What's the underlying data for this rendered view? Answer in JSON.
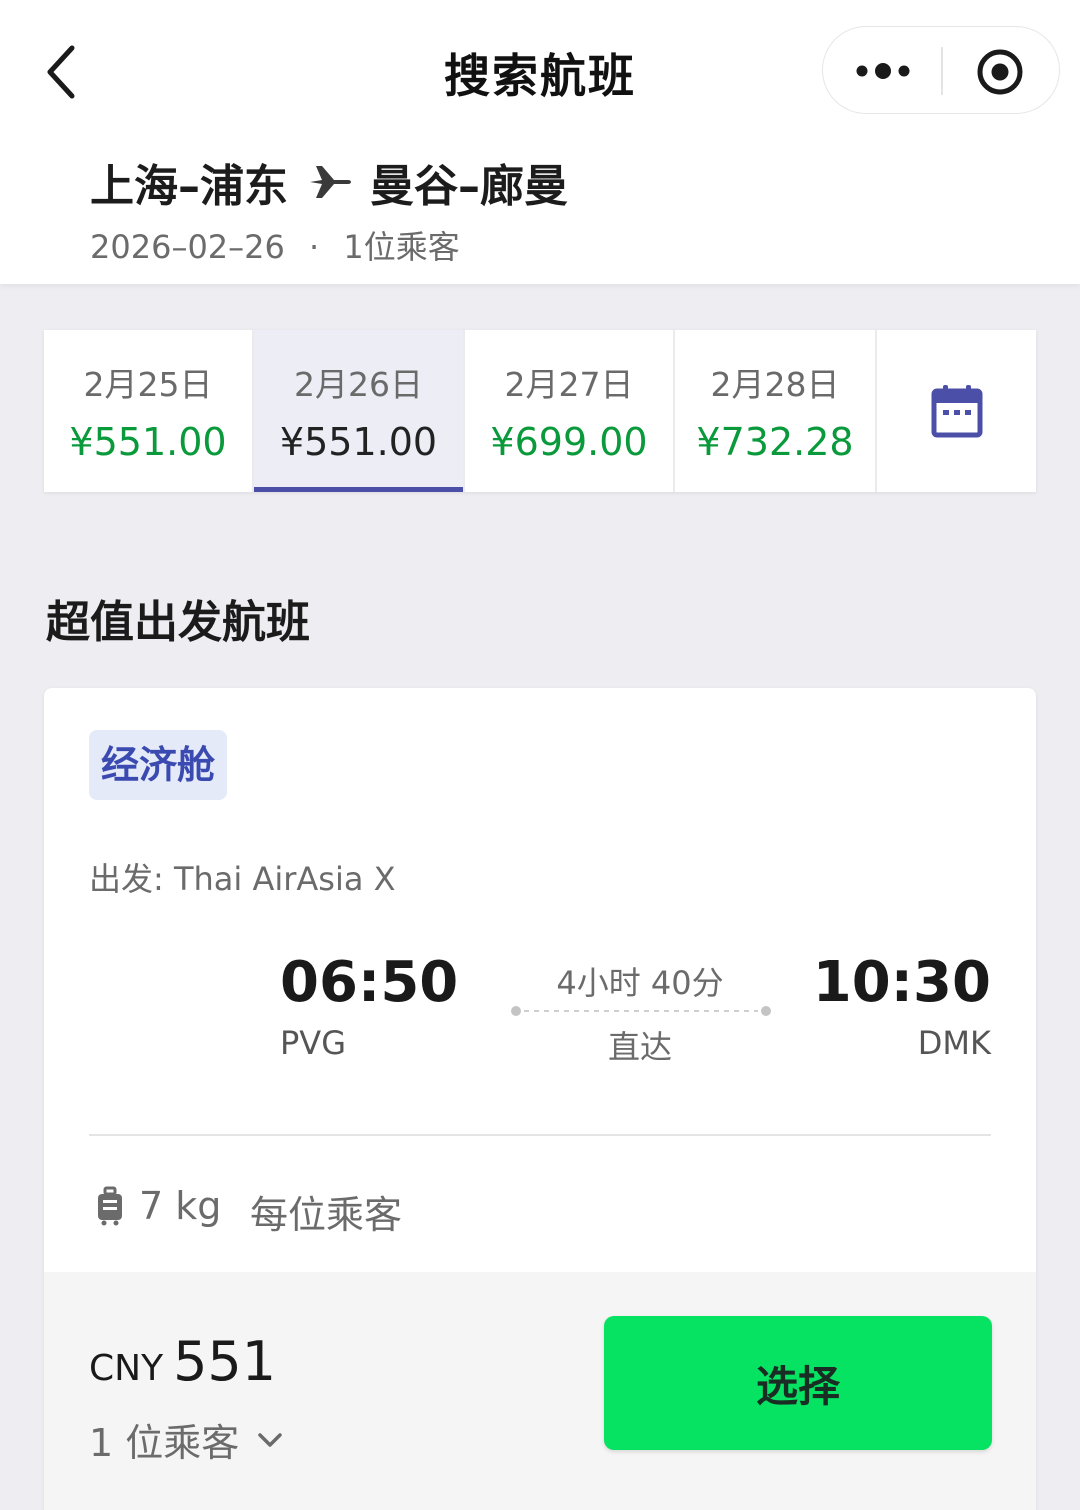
{
  "header": {
    "title": "搜索航班",
    "route_from": "上海–浦东",
    "route_to": "曼谷–廊曼",
    "date": "2026–02–26",
    "separator": "·",
    "passengers": "1位乘客"
  },
  "dates": [
    {
      "date": "2月25日",
      "price": "¥551.00",
      "selected": false
    },
    {
      "date": "2月26日",
      "price": "¥551.00",
      "selected": true
    },
    {
      "date": "2月27日",
      "price": "¥699.00",
      "selected": false
    },
    {
      "date": "2月28日",
      "price": "¥732.28",
      "selected": false
    }
  ],
  "section_title": "超值出发航班",
  "flight": {
    "cabin": "经济舱",
    "airline": "出发: Thai AirAsia X",
    "departure_time": "06:50",
    "departure_code": "PVG",
    "arrival_time": "10:30",
    "arrival_code": "DMK",
    "duration": "4小时 40分",
    "stops": "直达",
    "baggage_weight": "7 kg",
    "baggage_note": "每位乘客",
    "currency": "CNY",
    "price": "551",
    "pax_label": "1 位乘客",
    "select_label": "选择"
  },
  "colors": {
    "accent": "#4b4fa8",
    "price_green": "#0a9a3c",
    "select_button": "#06e261",
    "cabin_badge_bg": "#e4eaf8"
  },
  "icons": [
    "back-chevron-icon",
    "more-dots-icon",
    "target-icon",
    "plane-icon",
    "calendar-icon",
    "luggage-icon",
    "chevron-down-icon"
  ]
}
